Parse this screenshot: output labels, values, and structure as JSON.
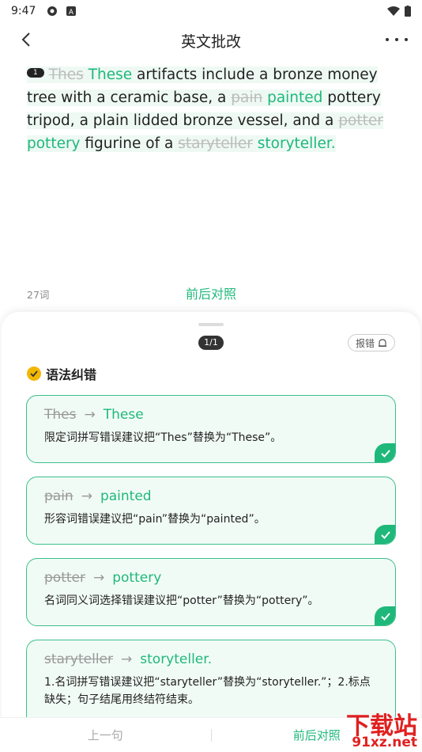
{
  "status": {
    "time": "9:47"
  },
  "header": {
    "title": "英文批改"
  },
  "essay": {
    "badge": "1",
    "segments": {
      "s1_old": "Thes",
      "s1_new": "These",
      "t1": " artifacts include a bronze money tree with a ceramic base, a ",
      "s2_old": "pain",
      "s2_new": "painted",
      "t2": " pottery tripod, a plain lidded bronze vessel, and a ",
      "s3_old": "potter",
      "s3_new": "pottery",
      "t3": " figurine of a ",
      "s4_old": "staryteller",
      "s4_new": "storyteller."
    }
  },
  "meta": {
    "word_count": "27词",
    "compare_label": "前后对照"
  },
  "sheet": {
    "pager": "1/1",
    "report": "报错",
    "section_title": "语法纠错",
    "cards": [
      {
        "old": "Thes",
        "new": "These",
        "desc": "限定词拼写错误建议把“Thes”替换为“These”。"
      },
      {
        "old": "pain",
        "new": "painted",
        "desc": "形容词错误建议把“pain”替换为“painted”。"
      },
      {
        "old": "potter",
        "new": "pottery",
        "desc": "名词同义词选择错误建议把“potter”替换为“pottery”。"
      },
      {
        "old": "staryteller",
        "new": "storyteller.",
        "desc": "1.名词拼写错误建议把“staryteller”替换为“storyteller.”；2.标点缺失；句子结尾用终结符结束。"
      }
    ]
  },
  "bottom": {
    "prev": "上一句",
    "compare": "前后对照"
  },
  "watermark": {
    "big": "下载站",
    "small": "91xz.net"
  },
  "colors": {
    "accent": "#1fb87b",
    "card_bg": "#f1fbf6",
    "strike": "#bcbcbc"
  }
}
